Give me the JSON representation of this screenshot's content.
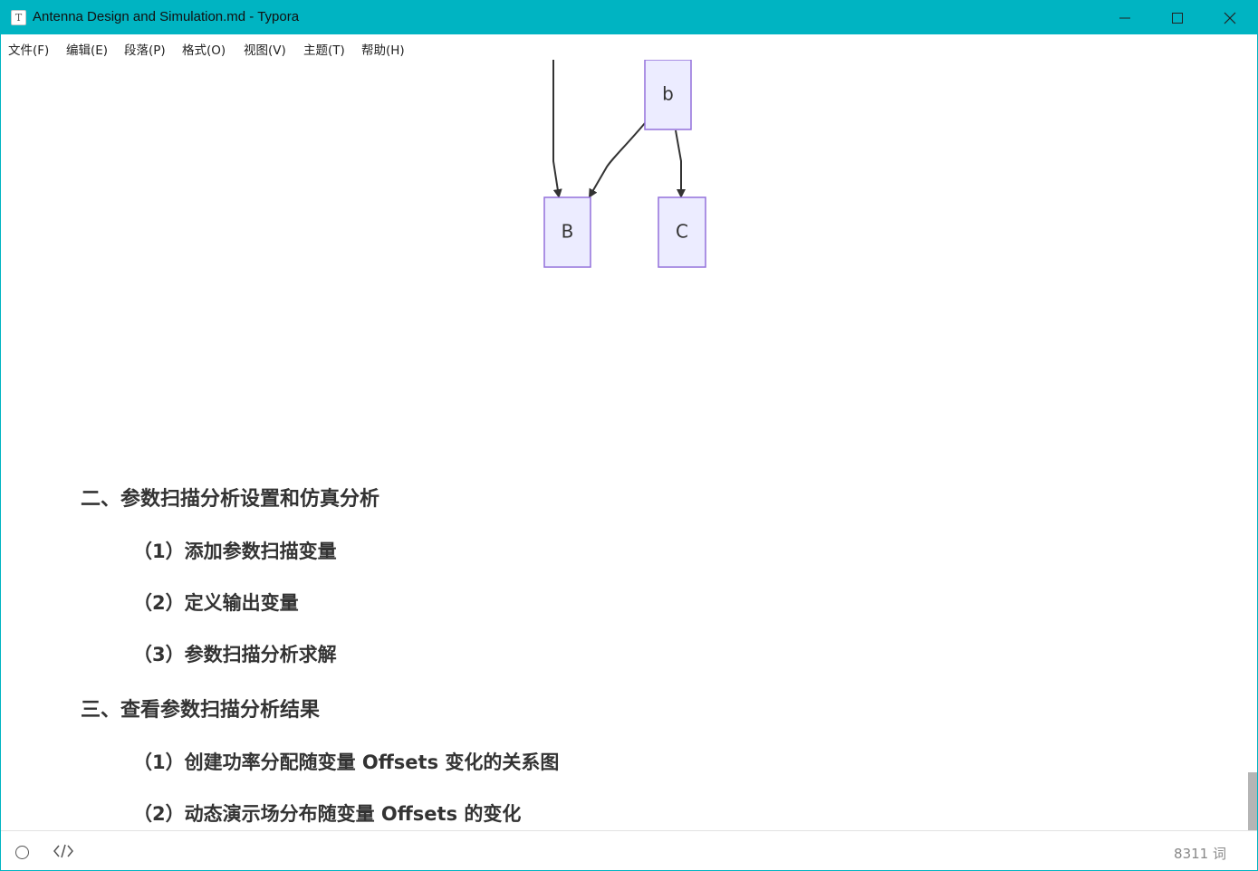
{
  "window": {
    "app_icon_letter": "T",
    "title": "Antenna Design and Simulation.md - Typora",
    "accent_color": "#00b4c2"
  },
  "menu": [
    {
      "label": "文件(F)"
    },
    {
      "label": "编辑(E)"
    },
    {
      "label": "段落(P)"
    },
    {
      "label": "格式(O)"
    },
    {
      "label": "视图(V)"
    },
    {
      "label": "主题(T)"
    },
    {
      "label": "帮助(H)"
    }
  ],
  "diagram": {
    "nodes": [
      "b",
      "B",
      "C"
    ],
    "node_fill": "#ececff",
    "node_stroke": "#9370db"
  },
  "outline": [
    {
      "level": 2,
      "text": "二、参数扫描分析设置和仿真分析"
    },
    {
      "level": 3,
      "text": "（1）添加参数扫描变量"
    },
    {
      "level": 3,
      "text": "（2）定义输出变量"
    },
    {
      "level": 3,
      "text": "（3）参数扫描分析求解"
    },
    {
      "level": 2,
      "text": "三、查看参数扫描分析结果"
    },
    {
      "level": 3,
      "text": "（1）创建功率分配随变量 Offsets 变化的关系图"
    },
    {
      "level": 3,
      "text": "（2）动态演示场分布随变量 Offsets 的变化"
    }
  ],
  "status": {
    "word_count": "8311 词",
    "outline_icon": "circle-icon",
    "source_icon": "code-icon"
  }
}
